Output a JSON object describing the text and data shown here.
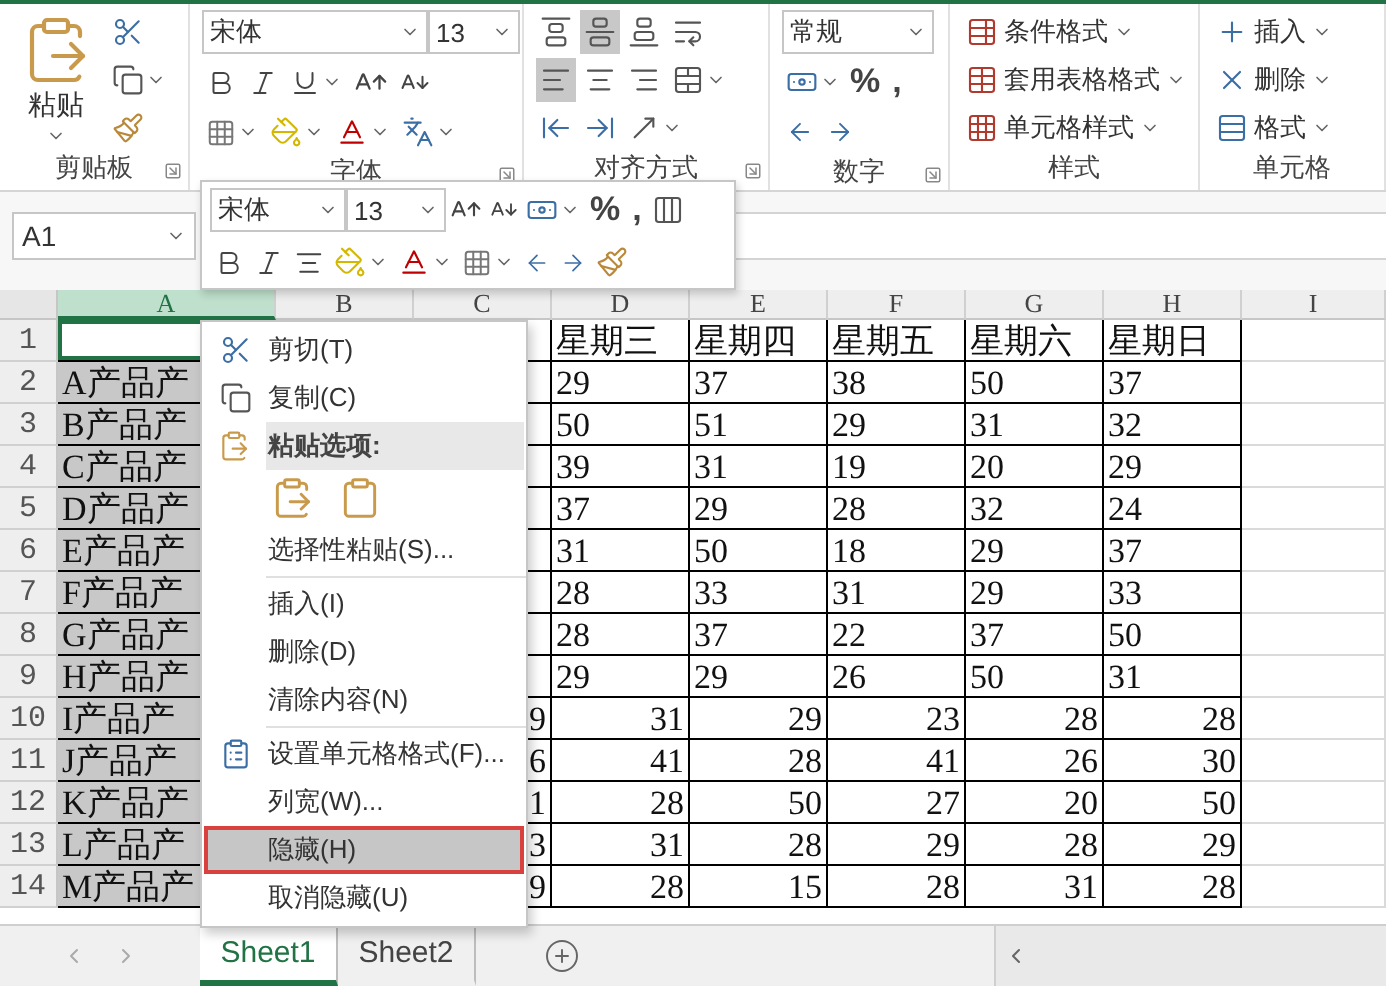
{
  "ribbon": {
    "clipboard": {
      "paste_label": "粘贴",
      "group_label": "剪贴板"
    },
    "font": {
      "font_name": "宋体",
      "font_size": "13",
      "group_label": "字体"
    },
    "alignment": {
      "vertical": [
        {
          "selected": false
        },
        {
          "selected": true
        },
        {
          "selected": false
        }
      ],
      "horizontal": [
        {
          "selected": true
        },
        {
          "selected": false
        },
        {
          "selected": false
        }
      ],
      "group_label": "对齐方式"
    },
    "number": {
      "format": "常规",
      "percent": "%",
      "comma": ",",
      "group_label": "数字"
    },
    "styles": {
      "items": [
        "条件格式",
        "套用表格格式",
        "单元格样式"
      ],
      "group_label": "样式"
    },
    "cells": {
      "items": [
        "插入",
        "删除",
        "格式"
      ],
      "group_label": "单元格"
    }
  },
  "name_box": {
    "value": "A1"
  },
  "mini_toolbar": {
    "font_name": "宋体",
    "font_size": "13",
    "percent": "%",
    "comma": ","
  },
  "sheet": {
    "columns": [
      {
        "label": "A",
        "selected": true
      },
      {
        "label": "B",
        "selected": false
      },
      {
        "label": "C",
        "selected": false
      },
      {
        "label": "D",
        "selected": false
      },
      {
        "label": "E",
        "selected": false
      },
      {
        "label": "F",
        "selected": false
      },
      {
        "label": "G",
        "selected": false
      },
      {
        "label": "H",
        "selected": false
      },
      {
        "label": "I",
        "selected": false
      }
    ],
    "rows": [
      {
        "number": "1",
        "right_aligned": false,
        "cells": [
          null,
          null,
          null,
          "星期三",
          "星期四",
          "星期五",
          "星期六",
          "星期日",
          null
        ]
      },
      {
        "number": "2",
        "right_aligned": false,
        "cells": [
          "A产品产",
          null,
          null,
          "29",
          "37",
          "38",
          "50",
          "37",
          null
        ]
      },
      {
        "number": "3",
        "right_aligned": false,
        "cells": [
          "B产品产",
          null,
          null,
          "50",
          "51",
          "29",
          "31",
          "32",
          null
        ]
      },
      {
        "number": "4",
        "right_aligned": false,
        "cells": [
          "C产品产",
          null,
          null,
          "39",
          "31",
          "19",
          "20",
          "29",
          null
        ]
      },
      {
        "number": "5",
        "right_aligned": false,
        "cells": [
          "D产品产",
          null,
          null,
          "37",
          "29",
          "28",
          "32",
          "24",
          null
        ]
      },
      {
        "number": "6",
        "right_aligned": false,
        "cells": [
          "E产品产",
          null,
          null,
          "31",
          "50",
          "18",
          "29",
          "37",
          null
        ]
      },
      {
        "number": "7",
        "right_aligned": false,
        "cells": [
          "F产品产",
          null,
          null,
          "28",
          "33",
          "31",
          "29",
          "33",
          null
        ]
      },
      {
        "number": "8",
        "right_aligned": false,
        "cells": [
          "G产品产",
          null,
          null,
          "28",
          "37",
          "22",
          "37",
          "50",
          null
        ]
      },
      {
        "number": "9",
        "right_aligned": false,
        "cells": [
          "H产品产",
          null,
          null,
          "29",
          "29",
          "26",
          "50",
          "31",
          null
        ]
      },
      {
        "number": "10",
        "right_aligned": true,
        "cells": [
          "I产品产",
          null,
          "9",
          "31",
          "29",
          "23",
          "28",
          "28",
          null
        ]
      },
      {
        "number": "11",
        "right_aligned": true,
        "cells": [
          "J产品产",
          null,
          "6",
          "41",
          "28",
          "41",
          "26",
          "30",
          null
        ]
      },
      {
        "number": "12",
        "right_aligned": true,
        "cells": [
          "K产品产",
          null,
          "1",
          "28",
          "50",
          "27",
          "20",
          "50",
          null
        ]
      },
      {
        "number": "13",
        "right_aligned": true,
        "cells": [
          "L产品产",
          null,
          "3",
          "31",
          "28",
          "29",
          "28",
          "29",
          null
        ]
      },
      {
        "number": "14",
        "right_aligned": true,
        "cells": [
          "M产品产",
          null,
          "9",
          "28",
          "15",
          "28",
          "31",
          "28",
          null
        ]
      }
    ]
  },
  "context_menu": [
    {
      "kind": "item",
      "label": "剪切(T)",
      "selected": false
    },
    {
      "kind": "item",
      "label": "复制(C)",
      "selected": false
    },
    {
      "kind": "header",
      "label": "粘贴选项:"
    },
    {
      "kind": "paste_options"
    },
    {
      "kind": "item",
      "label": "选择性粘贴(S)...",
      "selected": false
    },
    {
      "kind": "separator"
    },
    {
      "kind": "item",
      "label": "插入(I)",
      "selected": false
    },
    {
      "kind": "item",
      "label": "删除(D)",
      "selected": false
    },
    {
      "kind": "item",
      "label": "清除内容(N)",
      "selected": false
    },
    {
      "kind": "separator"
    },
    {
      "kind": "item",
      "label": "设置单元格格式(F)...",
      "selected": false
    },
    {
      "kind": "item",
      "label": "列宽(W)...",
      "selected": false
    },
    {
      "kind": "item",
      "label": "隐藏(H)",
      "selected": true
    },
    {
      "kind": "item",
      "label": "取消隐藏(U)",
      "selected": false
    }
  ],
  "sheet_tabs": [
    {
      "label": "Sheet1",
      "selected": true
    },
    {
      "label": "Sheet2",
      "selected": false
    }
  ]
}
